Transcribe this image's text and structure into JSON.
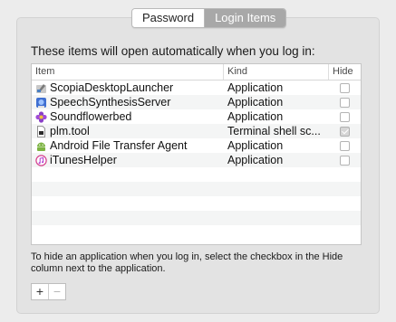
{
  "tabs": [
    {
      "label": "Password",
      "active": false
    },
    {
      "label": "Login Items",
      "active": true
    }
  ],
  "heading": "These items will open automatically when you log in:",
  "table": {
    "columns": {
      "item": "Item",
      "kind": "Kind",
      "hide": "Hide"
    },
    "rows": [
      {
        "name": "ScopiaDesktopLauncher",
        "kind": "Application",
        "hide": false,
        "icon": "launcher-app-icon"
      },
      {
        "name": "SpeechSynthesisServer",
        "kind": "Application",
        "hide": false,
        "icon": "speech-app-icon"
      },
      {
        "name": "Soundflowerbed",
        "kind": "Application",
        "hide": false,
        "icon": "flower-app-icon"
      },
      {
        "name": "plm.tool",
        "kind": "Terminal shell sc...",
        "hide": true,
        "icon": "terminal-script-icon"
      },
      {
        "name": "Android File Transfer Agent",
        "kind": "Application",
        "hide": false,
        "icon": "android-app-icon"
      },
      {
        "name": "iTunesHelper",
        "kind": "Application",
        "hide": false,
        "icon": "itunes-app-icon"
      }
    ]
  },
  "footer_text": "To hide an application when you log in, select the checkbox in the Hide column next to the application.",
  "buttons": {
    "add": "+",
    "remove": "−"
  },
  "colors": {
    "window_bg": "#ececec",
    "tab_active": "#a8a8a8",
    "panel_bg": "#e3e3e3",
    "row_alt": "#f4f5f5"
  }
}
